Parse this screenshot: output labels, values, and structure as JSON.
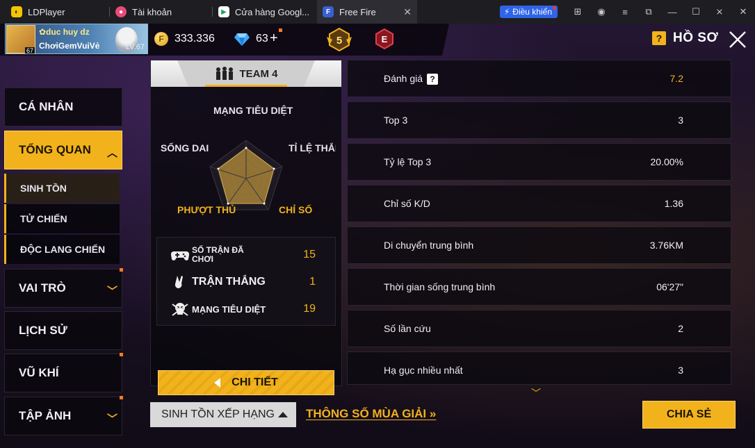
{
  "titlebar": {
    "tabs": [
      {
        "label": "LDPlayer",
        "icon": "ldplayer-icon"
      },
      {
        "label": "Tài khoản",
        "icon": "account-icon"
      },
      {
        "label": "Cửa hàng Googl...",
        "icon": "play-store-icon"
      },
      {
        "label": "Free Fire",
        "icon": "free-fire-icon"
      }
    ],
    "control_label": "Điều khiển"
  },
  "profile": {
    "name": "✿duc huy dz",
    "clan": "ChơiGemVuiVẻ",
    "level": "LV.67",
    "avatar_level": "67"
  },
  "currency": {
    "gold": "333.336",
    "diamonds": "63",
    "plus": "+"
  },
  "rank_badge": "5",
  "tier_badge": "E",
  "header": {
    "title": "HỒ SƠ",
    "help_icon": "?"
  },
  "menu": {
    "items": [
      {
        "label": "CÁ NHÂN"
      },
      {
        "label": "TỔNG QUAN"
      },
      {
        "label": "VAI TRÒ"
      },
      {
        "label": "LỊCH SỬ"
      },
      {
        "label": "VŨ KHÍ"
      },
      {
        "label": "TẬP ẢNH"
      }
    ],
    "sub_items": [
      {
        "label": "SINH TỒN"
      },
      {
        "label": "TỬ CHIẾN"
      },
      {
        "label": "ĐỘC LANG CHIẾN"
      }
    ]
  },
  "team": {
    "label": "TEAM 4"
  },
  "radar": {
    "labels": {
      "top": "MẠNG TIÊU DIỆT",
      "left": "SỐNG DAI",
      "right": "TỈ LỆ THẮNG",
      "bottom_left": "PHƯỢT THỦ",
      "bottom_right": "CHỈ SỐ"
    }
  },
  "summary_stats": [
    {
      "label": "SỐ TRẬN ĐÃ CHƠI",
      "value": "15",
      "icon": "gamepad-icon"
    },
    {
      "label": "TRẬN THẮNG",
      "value": "1",
      "icon": "victory-hand-icon"
    },
    {
      "label": "MẠNG TIÊU DIỆT",
      "value": "19",
      "icon": "skull-icon"
    }
  ],
  "detail_button": "CHI TIẾT",
  "stats": [
    {
      "label": "Đánh giá",
      "value": "7.2",
      "help": "?"
    },
    {
      "label": "Top 3",
      "value": "3"
    },
    {
      "label": "Tỷ lệ Top 3",
      "value": "20.00%"
    },
    {
      "label": "Chỉ số K/D",
      "value": "1.36"
    },
    {
      "label": "Di chuyển trung bình",
      "value": "3.76KM"
    },
    {
      "label": "Thời gian sống trung bình",
      "value": "06'27\""
    },
    {
      "label": "Số lần cứu",
      "value": "2"
    },
    {
      "label": "Hạ gục nhiều nhất",
      "value": "3"
    }
  ],
  "bottom": {
    "mode_select": "SINH TỒN XẾP HẠNG",
    "season_link": "THÔNG SỐ MÙA GIẢI",
    "season_arrows": "»",
    "share_button": "CHIA SẺ"
  },
  "colors": {
    "accent": "#f2b21c",
    "panel": "#0c0a10"
  }
}
